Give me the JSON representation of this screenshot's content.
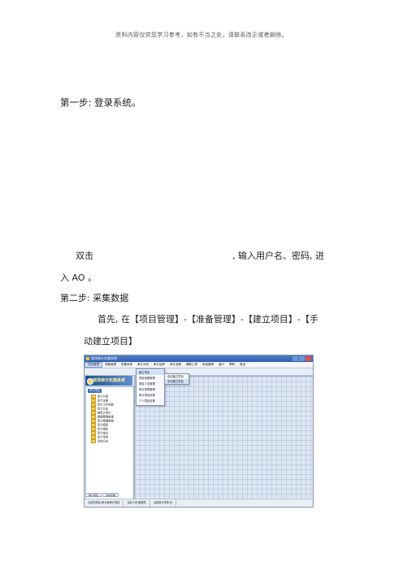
{
  "disclaimer": "资料内容仅供您学习参考，如有不当之处，请联系改正或者删除。",
  "step1": "第一步: 登录系统。",
  "double_click": "双击",
  "login_instruction": ", 输入用户名、密码, 进",
  "enter_ao": "入 AO 。",
  "step2": "第二步: 采集数据",
  "instruction_line1": "首先, 在【项目管理】-【准备管理】-【建立项目】-【手",
  "instruction_line2": "动建立项目】",
  "screenshot": {
    "window_title": "现场审计实施系统",
    "menu": [
      "项目管理",
      "准备管理",
      "采集转换",
      "审计分析",
      "审计抽样",
      "审计底稿",
      "辅助工具",
      "系统管理",
      "窗口",
      "帮助",
      "退出"
    ],
    "banner_text": "现场审计实施系统",
    "tree_root": "审计项目",
    "tree_items": [
      "审计方案",
      "审计证据",
      "审计工作底稿",
      "审计日志",
      "被审计单位",
      "数据整理结果",
      "审计整理数据",
      "审计模型",
      "审计报告",
      "审计结论",
      "审计事项",
      "系统日志"
    ],
    "left_tabs": [
      "审计项目",
      "系统管理"
    ],
    "dropdown_items": [
      "建立项目",
      "项目参数管理",
      "项目人员管理",
      "审计事项管理",
      "审计项目设置",
      "个人项目设置"
    ],
    "submenu_items": [
      "自动建立项目",
      "手动建立项目"
    ],
    "status": [
      "当前的项目:审计局审计项目",
      "当前人员:管理员",
      "当前审计事项:无"
    ]
  }
}
